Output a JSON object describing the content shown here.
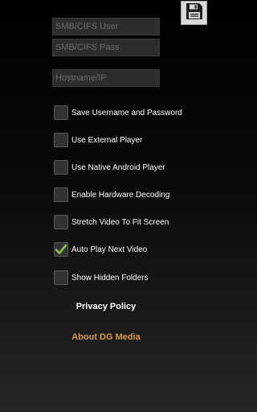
{
  "toolbar": {
    "save_icon": "floppy-disk-icon"
  },
  "fields": {
    "smb_user": {
      "placeholder": "SMB/CIFS User",
      "value": ""
    },
    "smb_pass": {
      "placeholder": "SMB/CIFS Pass",
      "value": ""
    },
    "hostname": {
      "placeholder": "Hostname/IP",
      "value": ""
    }
  },
  "options": [
    {
      "label": "Save Username and Password",
      "checked": false
    },
    {
      "label": "Use External Player",
      "checked": false
    },
    {
      "label": "Use Native Android Player",
      "checked": false
    },
    {
      "label": "Enable Hardware Decoding",
      "checked": false
    },
    {
      "label": "Stretch Video To Fit Screen",
      "checked": false
    },
    {
      "label": "Auto Play Next Video",
      "checked": true
    },
    {
      "label": "Show Hidden Folders",
      "checked": false
    }
  ],
  "links": {
    "privacy": "Privacy Policy",
    "about": "About DG Media"
  },
  "colors": {
    "check_mark": "#8bc34a",
    "about_link": "#d99a4e",
    "privacy_link": "#ffffff"
  }
}
